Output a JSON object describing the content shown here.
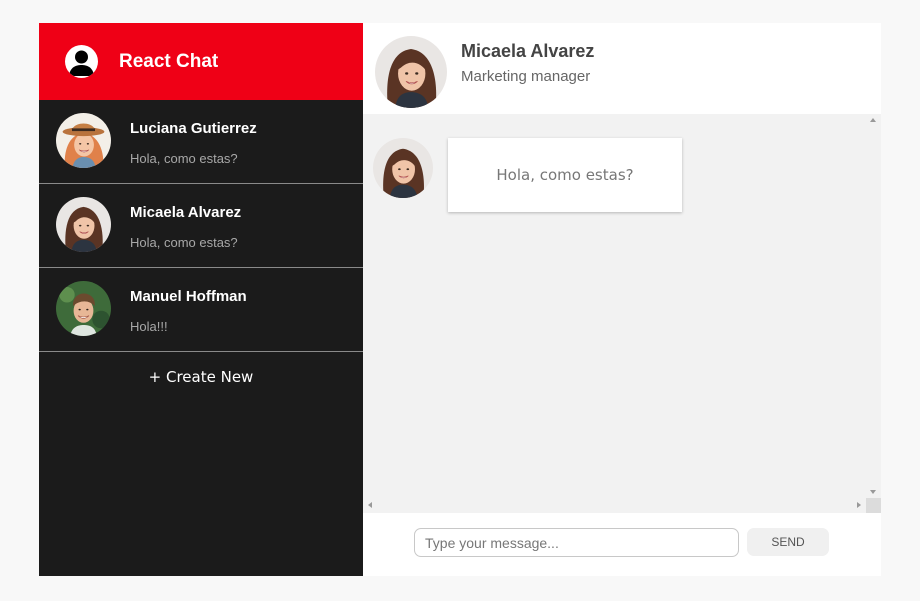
{
  "sidebar": {
    "title": "React Chat",
    "header_color": "#ef0016",
    "contacts": [
      {
        "name": "Luciana Gutierrez",
        "preview": "Hola, como estas?",
        "avatar": "woman-hat-avatar"
      },
      {
        "name": "Micaela Alvarez",
        "preview": "Hola, como estas?",
        "avatar": "woman-avatar"
      },
      {
        "name": "Manuel Hoffman",
        "preview": "Hola!!!",
        "avatar": "man-avatar"
      }
    ],
    "create_new_label": "+ Create New"
  },
  "chat": {
    "contact_name": "Micaela Alvarez",
    "contact_role": "Marketing manager",
    "messages": [
      {
        "text": "Hola, como estas?"
      }
    ]
  },
  "composer": {
    "placeholder": "Type your message...",
    "send_label": "SEND"
  }
}
